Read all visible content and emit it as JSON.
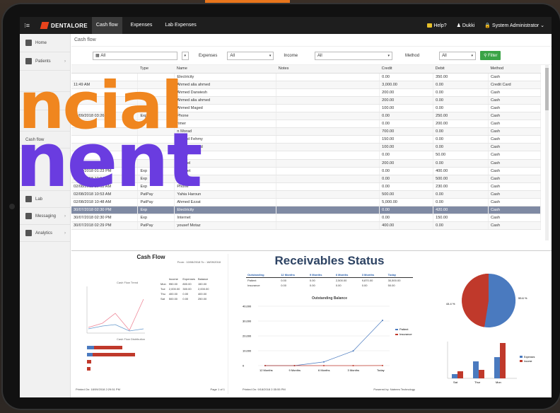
{
  "topbar": {
    "menu_icon": "menu-icon",
    "brand": "DENTALORE",
    "tabs": [
      "Cash flow",
      "Expenses",
      "Lab Expenses"
    ],
    "help": "Help?",
    "user": "Dukki",
    "role": "System Administrator"
  },
  "sidebar": {
    "items": [
      "Home",
      "Patients",
      "Recall",
      "Cash flow",
      "Lab",
      "Messaging",
      "Analytics"
    ]
  },
  "crumb": "Cash flow",
  "filters": {
    "date": "All",
    "expenses_label": "Expenses",
    "expenses_value": "All",
    "income_label": "Income",
    "income_value": "All",
    "method_label": "Method",
    "method_value": "All",
    "filter_button": "Filter"
  },
  "table": {
    "headers": [
      "",
      "Type",
      "Name",
      "Notes",
      "Credit",
      "Debit",
      "Method"
    ],
    "rows": [
      [
        "",
        "",
        "Electricity",
        "",
        "0.00",
        "350.00",
        "Cash"
      ],
      [
        "11:49 AM",
        "",
        "Ahmed alia ahmed",
        "",
        "3,000.00",
        "0.00",
        "Credit Card"
      ],
      [
        "",
        "",
        "Ahmed Darwiesh",
        "",
        "200.00",
        "0.00",
        "Cash"
      ],
      [
        "",
        "",
        "Ahmed alia ahmed",
        "",
        "200.00",
        "0.00",
        "Cash"
      ],
      [
        "",
        "",
        "Ahmed Maged",
        "",
        "100.00",
        "0.00",
        "Cash"
      ],
      [
        "03/09/2018 03:26 PM",
        "Exp",
        "Phone",
        "",
        "0.00",
        "250.00",
        "Cash"
      ],
      [
        "",
        "",
        "rimer",
        "",
        "0.00",
        "200.00",
        "Cash"
      ],
      [
        "",
        "",
        "n Morad",
        "",
        "700.00",
        "0.00",
        "Cash"
      ],
      [
        "",
        "",
        "Ahmed Fehmy",
        "",
        "150.00",
        "0.00",
        "Cash"
      ],
      [
        "",
        "",
        "Ahmed Maged",
        "",
        "100.00",
        "0.00",
        "Cash"
      ],
      [
        "",
        "",
        "ctricity",
        "",
        "0.00",
        "50.00",
        "Cash"
      ],
      [
        "",
        "",
        "ka wael",
        "",
        "200.00",
        "0.00",
        "Cash"
      ],
      [
        "06/08/2018 01:23 PM",
        "Exp",
        "Internet",
        "",
        "0.00",
        "400.00",
        "Cash"
      ],
      [
        "02/08/2018 10:54 AM",
        "Exp",
        "Electricity",
        "",
        "0.00",
        "500.00",
        "Cash"
      ],
      [
        "02/08/2018 10:53 AM",
        "Exp",
        "Phone",
        "",
        "0.00",
        "230.00",
        "Cash"
      ],
      [
        "02/08/2018 10:53 AM",
        "PatPay",
        "Yahia Haroun",
        "",
        "500.00",
        "0.00",
        "Cash"
      ],
      [
        "02/08/2018 10:48 AM",
        "PatPay",
        "Ahmed Ezzat",
        "",
        "5,000.00",
        "0.00",
        "Cash"
      ],
      [
        "30/07/2018 02:30 PM",
        "Exp",
        "Electricity",
        "",
        "0.00",
        "420.00",
        "Cash"
      ],
      [
        "30/07/2018 02:30 PM",
        "Exp",
        "Internet",
        "",
        "0.00",
        "150.00",
        "Cash"
      ],
      [
        "30/07/2018 02:29 PM",
        "PatPay",
        "yousef Motaz",
        "",
        "400.00",
        "0.00",
        "Cash"
      ]
    ],
    "selected_row": 17
  },
  "overlay": {
    "line1": "ncial",
    "line2": "nent"
  },
  "report1": {
    "title": "Cash Flow",
    "range": "From : 10/08/2018     To : 18/09/2018",
    "chart1_title": "Cash Flow Trend",
    "chart2_title": "Cash Flow Distribution",
    "cols": [
      "Income",
      "Expenses",
      "Balance"
    ],
    "rows": [
      [
        "Mon",
        "950.00",
        "800.00",
        "150.00"
      ],
      [
        "Tue",
        "2,000.00",
        "300.00",
        "2,000.00"
      ],
      [
        "Thu",
        "400.00",
        "0.00",
        "400.00"
      ],
      [
        "Sat",
        "500.00",
        "0.00",
        "250.00"
      ]
    ],
    "legend": [
      "Expenses",
      "Income"
    ],
    "footer_left": "Printed On: 18/09/2018 2:29:51 PM",
    "footer_right": "Page 1 of 1"
  },
  "report2": {
    "title": "Receivables Status",
    "cols": [
      "Outstanding",
      "12 Months",
      "9 Months",
      "6 Months",
      "3 Months",
      "Today"
    ],
    "rows": [
      [
        "Patient",
        "0.00",
        "0.00",
        "2,500.00",
        "9,870.00",
        "30,500.00"
      ],
      [
        "Insurance",
        "0.00",
        "0.00",
        "0.00",
        "0.00",
        "50.00"
      ]
    ],
    "chart_title": "Outstanding Balance",
    "legend": [
      "Patient",
      "Insurance"
    ],
    "x": [
      "12 Months",
      "9 Months",
      "6 Months",
      "3 Months",
      "Today"
    ],
    "yticks": [
      "40,000",
      "30,000",
      "20,000",
      "10,000",
      "0"
    ],
    "footer_left": "Printed On: 9/18/2018 2:35:55 PM",
    "footer_right": "Powered by: Natrees Technology"
  },
  "report3": {
    "pie_labels": [
      "55.6 %",
      "44.4 %"
    ],
    "bar_cats": [
      "Sat",
      "Thur",
      "Mon"
    ],
    "legend": [
      "Expenses",
      "Income"
    ]
  },
  "chart_data": [
    {
      "type": "line",
      "title": "Outstanding Balance",
      "categories": [
        "12 Months",
        "9 Months",
        "6 Months",
        "3 Months",
        "Today"
      ],
      "series": [
        {
          "name": "Patient",
          "values": [
            0,
            0,
            2500,
            9870,
            30500
          ]
        },
        {
          "name": "Insurance",
          "values": [
            0,
            0,
            0,
            0,
            50
          ]
        }
      ],
      "ylim": [
        0,
        40000
      ]
    },
    {
      "type": "pie",
      "values": [
        55.6,
        44.4
      ],
      "labels": [
        "55.6 %",
        "44.4 %"
      ]
    },
    {
      "type": "bar",
      "categories": [
        "Sat",
        "Thur",
        "Mon"
      ],
      "series": [
        {
          "name": "Expenses",
          "values": [
            100,
            350,
            420
          ]
        },
        {
          "name": "Income",
          "values": [
            150,
            150,
            780
          ]
        }
      ]
    }
  ],
  "colors": {
    "accent": "#3aa346",
    "orange": "#f0861f",
    "purple": "#6a3ce0",
    "blue": "#4a7abf",
    "red": "#c0392b"
  }
}
